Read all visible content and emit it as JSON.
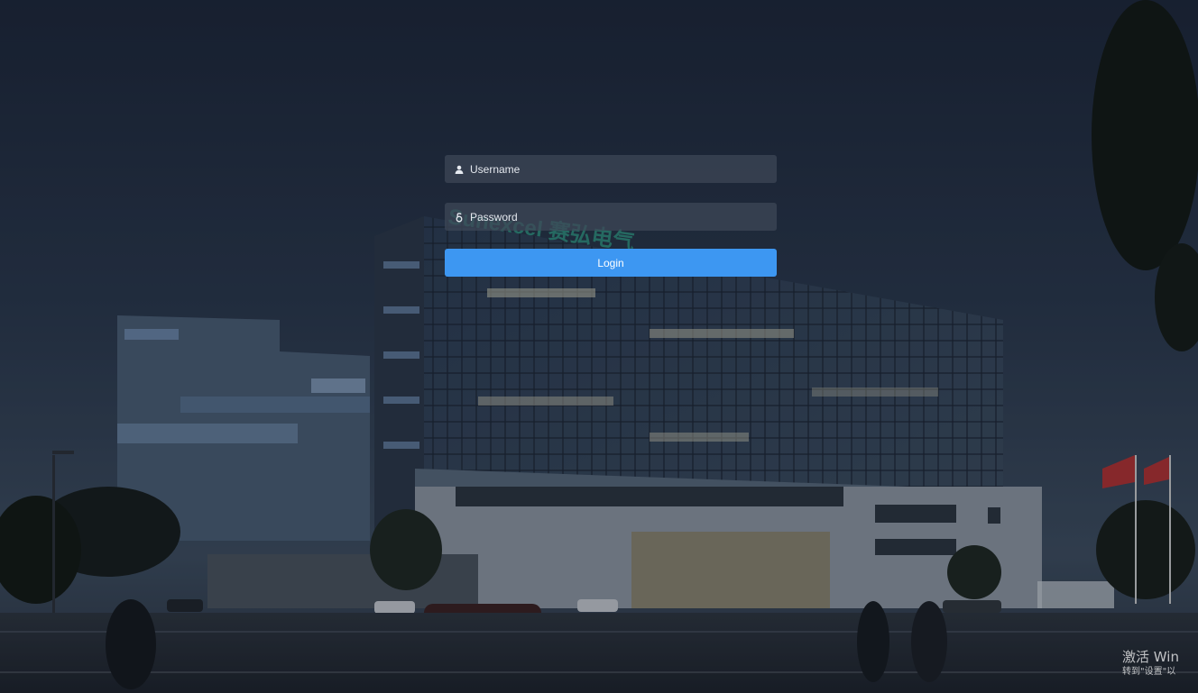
{
  "login": {
    "username_placeholder": "Username",
    "password_placeholder": "Password",
    "login_label": "Login"
  },
  "background": {
    "building_sign": "Sunexcel 赛弘电气"
  },
  "watermark": {
    "title": "激活 Win",
    "subtitle": "转到\"设置\"以"
  },
  "colors": {
    "accent": "#3d97f2",
    "field_bg": "#3e4858",
    "sky_top": "#1c2536",
    "sky_bottom": "#3b4b5e"
  },
  "icons": {
    "username": "user-icon",
    "password": "lock-icon"
  }
}
